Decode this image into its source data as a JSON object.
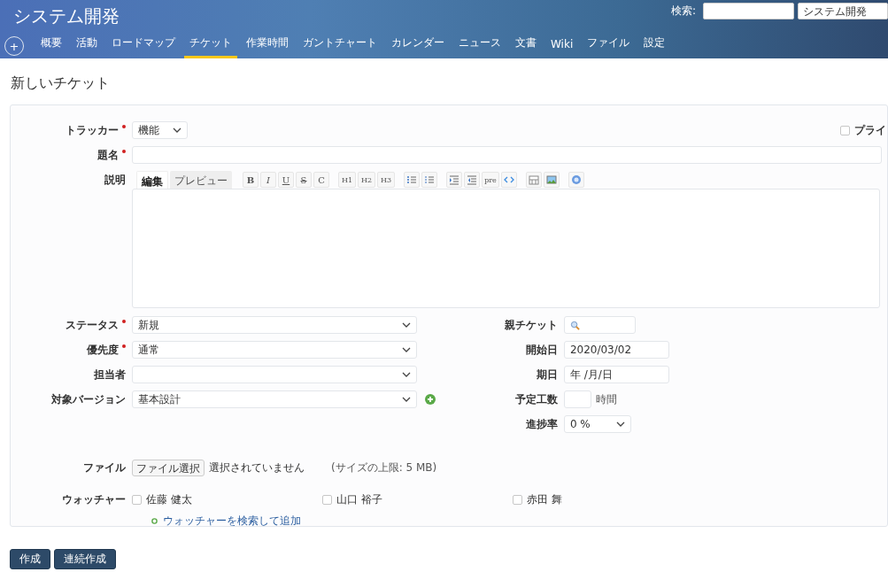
{
  "project": {
    "title": "システム開発"
  },
  "search": {
    "label": "検索:",
    "scope": "システム開発"
  },
  "new_button": "+",
  "tabs": [
    {
      "label": "概要",
      "selected": false
    },
    {
      "label": "活動",
      "selected": false
    },
    {
      "label": "ロードマップ",
      "selected": false
    },
    {
      "label": "チケット",
      "selected": true
    },
    {
      "label": "作業時間",
      "selected": false
    },
    {
      "label": "ガントチャート",
      "selected": false
    },
    {
      "label": "カレンダー",
      "selected": false
    },
    {
      "label": "ニュース",
      "selected": false
    },
    {
      "label": "文書",
      "selected": false
    },
    {
      "label": "Wiki",
      "selected": false
    },
    {
      "label": "ファイル",
      "selected": false
    },
    {
      "label": "設定",
      "selected": false
    }
  ],
  "page_title": "新しいチケット",
  "form": {
    "tracker": {
      "label": "トラッカー",
      "required": true,
      "value": "機能"
    },
    "private": {
      "label": "プライ",
      "checked": false
    },
    "subject": {
      "label": "題名",
      "required": true
    },
    "description": {
      "label": "説明",
      "tabs": [
        {
          "label": "編集",
          "selected": true
        },
        {
          "label": "プレビュー",
          "selected": false
        }
      ],
      "toolbar": [
        [
          {
            "kind": "bold",
            "label": "B"
          },
          {
            "kind": "italic",
            "label": "I"
          },
          {
            "kind": "underline",
            "label": "U"
          },
          {
            "kind": "strike",
            "label": "S"
          },
          {
            "kind": "text",
            "label": "C"
          }
        ],
        [
          {
            "kind": "small",
            "label": "H1"
          },
          {
            "kind": "small",
            "label": "H2"
          },
          {
            "kind": "small",
            "label": "H3"
          }
        ],
        [
          {
            "kind": "ul"
          },
          {
            "kind": "ol"
          }
        ],
        [
          {
            "kind": "indent"
          },
          {
            "kind": "outdent"
          },
          {
            "kind": "small",
            "label": "pre"
          },
          {
            "kind": "code"
          }
        ],
        [
          {
            "kind": "table"
          },
          {
            "kind": "image"
          }
        ],
        [
          {
            "kind": "help"
          }
        ]
      ]
    },
    "left_fields": [
      {
        "label": "ステータス",
        "required": true,
        "kind": "select",
        "value": "新規",
        "addable": false
      },
      {
        "label": "優先度",
        "required": true,
        "kind": "select",
        "value": "通常",
        "addable": false
      },
      {
        "label": "担当者",
        "required": false,
        "kind": "select",
        "addable": false
      },
      {
        "label": "対象バージョン",
        "required": false,
        "kind": "select",
        "value": "基本設計",
        "addable": true
      }
    ],
    "right_fields": [
      {
        "label": "親チケット",
        "kind": "search"
      },
      {
        "label": "開始日",
        "kind": "date",
        "value": "2020/03/02"
      },
      {
        "label": "期日",
        "kind": "date",
        "value": "年 /月/日"
      },
      {
        "label": "予定工数",
        "kind": "number",
        "unit": "時間"
      },
      {
        "label": "進捗率",
        "kind": "select",
        "value": "0 %"
      }
    ],
    "file": {
      "label": "ファイル",
      "button": "ファイル選択",
      "status": "選択されていません",
      "note": "(サイズの上限: 5 MB)"
    },
    "watchers": {
      "label": "ウォッチャー",
      "people": [
        {
          "name": "佐藤 健太",
          "checked": false
        },
        {
          "name": "山口 裕子",
          "checked": false
        },
        {
          "name": "赤田 舞",
          "checked": false
        }
      ],
      "add_link": "ウォッチャーを検索して追加"
    }
  },
  "buttons": [
    "作成",
    "連続作成"
  ]
}
